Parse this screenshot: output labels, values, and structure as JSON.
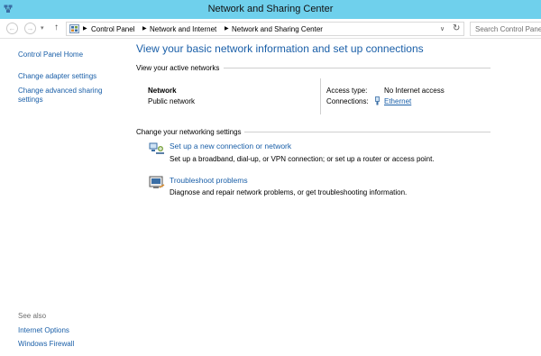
{
  "window": {
    "title": "Network and Sharing Center"
  },
  "address": {
    "crumbs": [
      "Control Panel",
      "Network and Internet",
      "Network and Sharing Center"
    ],
    "search_placeholder": "Search Control Panel"
  },
  "sidebar": {
    "home": "Control Panel Home",
    "links": [
      "Change adapter settings",
      "Change advanced sharing"
    ],
    "links_cont": "settings",
    "see_also": "See also",
    "see_also_links": [
      "Internet Options",
      "Windows Firewall"
    ]
  },
  "main": {
    "heading": "View your basic network information and set up connections",
    "active_label": "View your active networks",
    "network": {
      "name": "Network",
      "type": "Public network",
      "access_label": "Access type:",
      "access_value": "No Internet access",
      "connections_label": "Connections:",
      "connections_value": "Ethernet"
    },
    "settings_label": "Change your networking settings",
    "tasks": [
      {
        "title": "Set up a new connection or network",
        "desc": "Set up a broadband, dial-up, or VPN connection; or set up a router or access point.",
        "icon": "network-setup-icon"
      },
      {
        "title": "Troubleshoot problems",
        "desc": "Diagnose and repair network problems, or get troubleshooting information.",
        "icon": "troubleshoot-icon"
      }
    ]
  },
  "colors": {
    "titlebar": "#6fd0ec",
    "link": "#1a5fa8"
  }
}
